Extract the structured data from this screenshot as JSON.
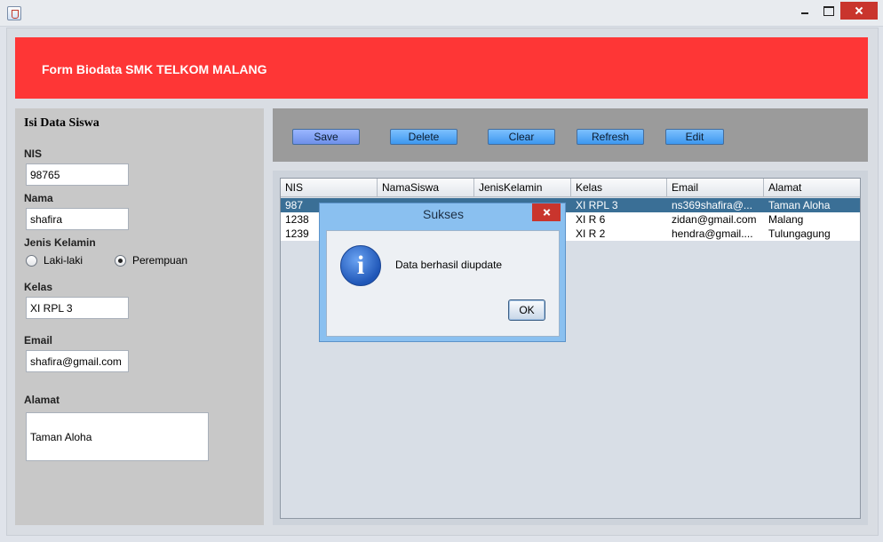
{
  "window": {
    "minimize_label": "",
    "maximize_label": "",
    "close_label": ""
  },
  "banner": {
    "title": "Form Biodata SMK TELKOM MALANG",
    "color": "#fe3636"
  },
  "form": {
    "section_title": "Isi Data Siswa",
    "nis": {
      "label": "NIS",
      "value": "98765"
    },
    "nama": {
      "label": "Nama",
      "value": "shafira"
    },
    "jenis_kelamin": {
      "label": "Jenis Kelamin",
      "options": [
        "Laki-laki",
        "Perempuan"
      ],
      "selected": "Perempuan"
    },
    "kelas": {
      "label": "Kelas",
      "value": "XI RPL 3"
    },
    "email": {
      "label": "Email",
      "value": "shafira@gmail.com"
    },
    "alamat": {
      "label": "Alamat",
      "value": "Taman Aloha"
    }
  },
  "toolbar": {
    "save": "Save",
    "delete": "Delete",
    "clear": "Clear",
    "refresh": "Refresh",
    "edit": "Edit"
  },
  "table": {
    "columns": [
      "NIS",
      "NamaSiswa",
      "JenisKelamin",
      "Kelas",
      "Email",
      "Alamat"
    ],
    "rows": [
      {
        "nis": "987",
        "nama": "",
        "jk": "",
        "kelas": "XI RPL 3",
        "email": "ns369shafira@...",
        "alamat": "Taman Aloha",
        "selected": true
      },
      {
        "nis": "1238",
        "nama": "",
        "jk": "",
        "kelas": "XI R 6",
        "email": "zidan@gmail.com",
        "alamat": "Malang",
        "selected": false
      },
      {
        "nis": "1239",
        "nama": "",
        "jk": "",
        "kelas": "XI R 2",
        "email": "hendra@gmail....",
        "alamat": "Tulungagung",
        "selected": false
      }
    ]
  },
  "dialog": {
    "title": "Sukses",
    "message": "Data berhasil diupdate",
    "ok": "OK",
    "icon": "info-icon"
  }
}
